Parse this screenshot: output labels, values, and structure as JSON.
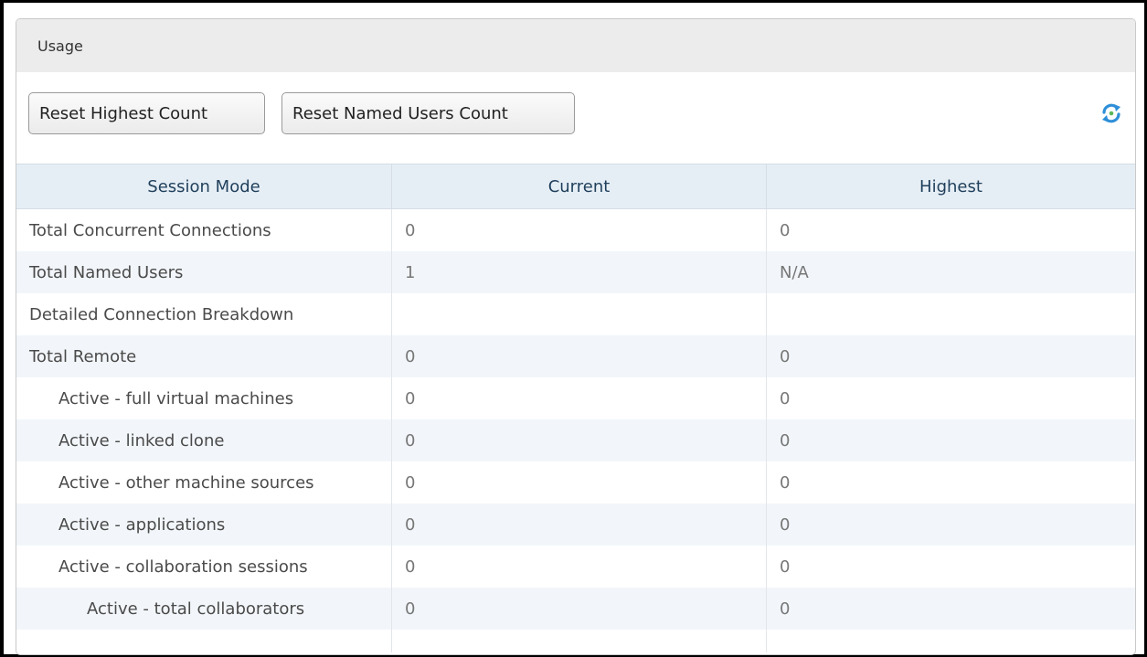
{
  "panel": {
    "title": "Usage"
  },
  "toolbar": {
    "reset_highest_label": "Reset Highest Count",
    "reset_named_label": "Reset Named Users Count",
    "refresh_icon": "refresh-icon"
  },
  "table": {
    "columns": [
      "Session Mode",
      "Current",
      "Highest"
    ],
    "rows": [
      {
        "mode": "Total Concurrent Connections",
        "current": "0",
        "highest": "0"
      },
      {
        "mode": "Total Named Users",
        "current": "1",
        "highest": "N/A"
      },
      {
        "mode": "Detailed Connection Breakdown",
        "current": "",
        "highest": ""
      },
      {
        "mode": "Total Remote",
        "current": "0",
        "highest": "0"
      },
      {
        "mode": "Active - full virtual machines",
        "current": "0",
        "highest": "0"
      },
      {
        "mode": "Active - linked clone",
        "current": "0",
        "highest": "0"
      },
      {
        "mode": "Active - other machine sources",
        "current": "0",
        "highest": "0"
      },
      {
        "mode": "Active - applications",
        "current": "0",
        "highest": "0"
      },
      {
        "mode": "Active - collaboration sessions",
        "current": "0",
        "highest": "0"
      },
      {
        "mode": "Active - total collaborators",
        "current": "0",
        "highest": "0"
      }
    ]
  },
  "colors": {
    "header_bg": "#ececec",
    "grid_header_bg": "#e6eef5",
    "alt_row_bg": "#f2f6fa",
    "header_text": "#1f3f5b",
    "refresh_blue": "#2f8fd8",
    "refresh_green": "#5cb85c"
  }
}
